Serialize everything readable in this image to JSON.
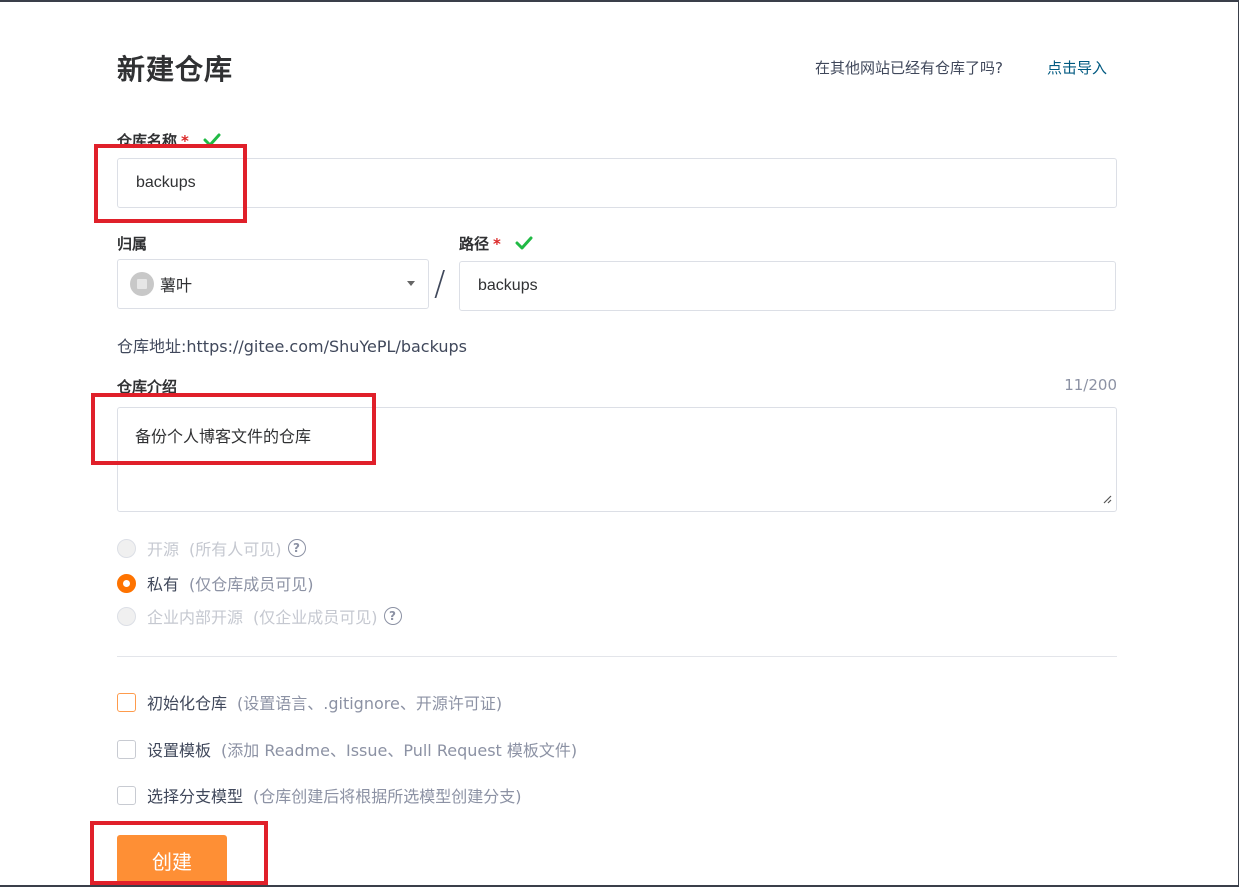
{
  "page": {
    "title": "新建仓库",
    "import_question": "在其他网站已经有仓库了吗?",
    "import_link": "点击导入"
  },
  "repo_name": {
    "label": "仓库名称",
    "required": "*",
    "value": "backups"
  },
  "owner": {
    "label": "归属",
    "value": "薯叶"
  },
  "separator": "/",
  "path": {
    "label": "路径",
    "required": "*",
    "value": "backups"
  },
  "address": "仓库地址:https://gitee.com/ShuYePL/backups",
  "description": {
    "label": "仓库介绍",
    "counter": "11/200",
    "value": "备份个人博客文件的仓库"
  },
  "visibility": [
    {
      "label": "开源",
      "note": "(所有人可见)",
      "selected": false,
      "disabled": true,
      "help": "?"
    },
    {
      "label": "私有",
      "note": "(仅仓库成员可见)",
      "selected": true,
      "disabled": false
    },
    {
      "label": "企业内部开源",
      "note": "(仅企业成员可见)",
      "selected": false,
      "disabled": true,
      "help": "?"
    }
  ],
  "options": [
    {
      "label": "初始化仓库",
      "note": "(设置语言、.gitignore、开源许可证)"
    },
    {
      "label": "设置模板",
      "note": "(添加 Readme、Issue、Pull Request 模板文件)"
    },
    {
      "label": "选择分支模型",
      "note": "(仓库创建后将根据所选模型创建分支)"
    }
  ],
  "submit_label": "创建",
  "colors": {
    "accent": "#fe7300",
    "button": "#fe8f35",
    "link": "#005980",
    "valid": "#21ba45",
    "highlight": "#e0202a"
  }
}
